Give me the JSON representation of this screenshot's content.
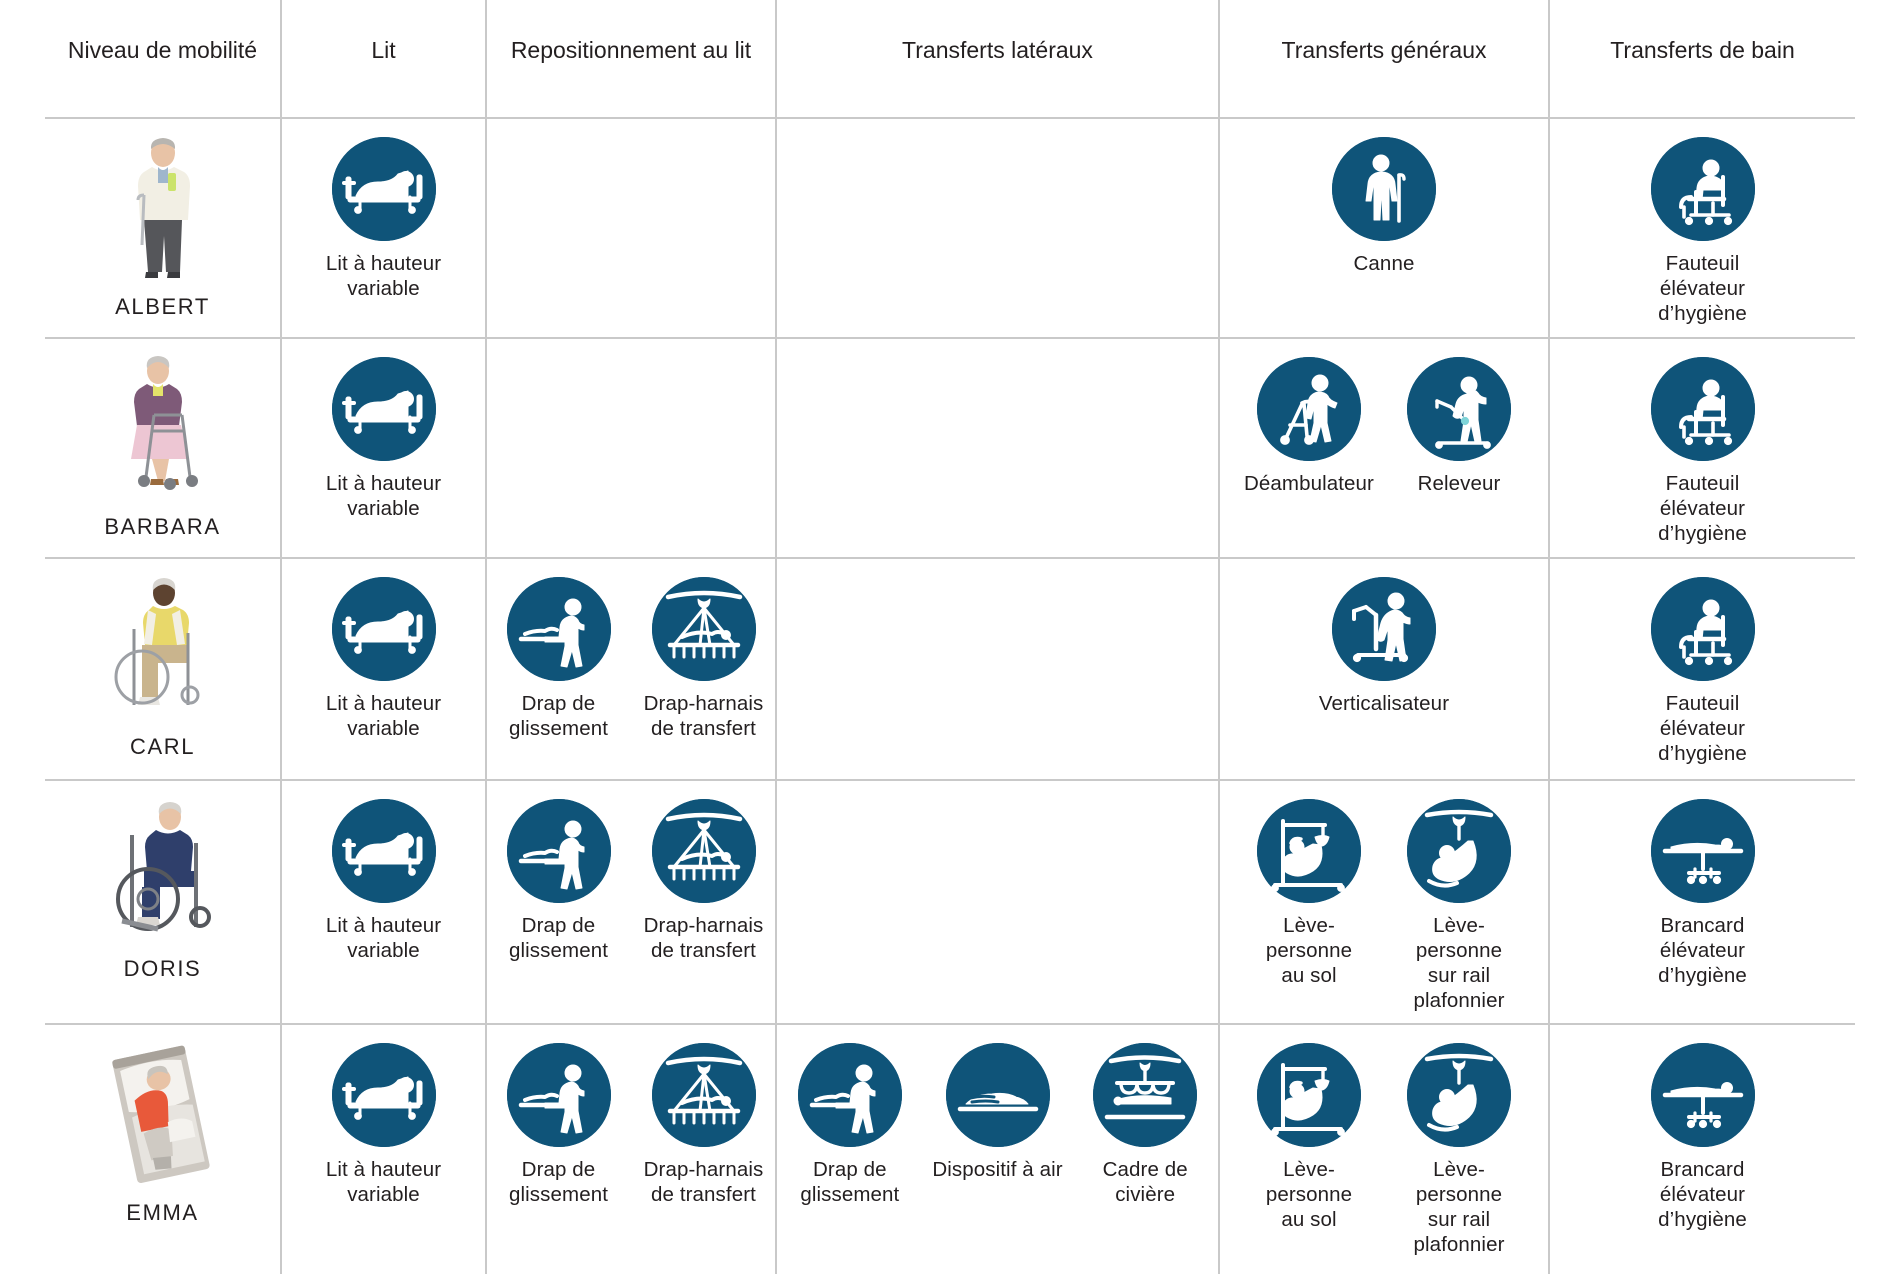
{
  "header": {
    "columns": [
      {
        "id": "mobility",
        "label": "Niveau\nde mobilité"
      },
      {
        "id": "bed",
        "label": "Lit"
      },
      {
        "id": "repositioning",
        "label": "Repositionnement au lit"
      },
      {
        "id": "lateral_transfers",
        "label": "Transferts latéraux"
      },
      {
        "id": "general_transfers",
        "label": "Transferts généraux"
      },
      {
        "id": "bath_transfers",
        "label": "Transferts\nde bain"
      }
    ]
  },
  "colors": {
    "badge_blue": "#0f5479",
    "grid_line": "#c9c9c9",
    "text": "#231f20",
    "page_background": "#ffffff"
  },
  "rows": [
    {
      "name": "ALBERT",
      "person_icon": "elderly-man-with-cane-photo",
      "bed": [
        {
          "label": "Lit à hauteur\nvariable",
          "icon": "height-adjustable-bed-icon"
        }
      ],
      "repositioning": [],
      "lateral_transfers": [],
      "general_transfers": [
        {
          "label": "Canne",
          "icon": "walking-cane-icon"
        }
      ],
      "bath_transfers": [
        {
          "label": "Fauteuil élévateur\nd’hygiène",
          "icon": "hygiene-lift-chair-icon"
        }
      ]
    },
    {
      "name": "BARBARA",
      "person_icon": "elderly-woman-with-rollator-photo",
      "bed": [
        {
          "label": "Lit à hauteur\nvariable",
          "icon": "height-adjustable-bed-icon"
        }
      ],
      "repositioning": [],
      "lateral_transfers": [],
      "general_transfers": [
        {
          "label": "Déambulateur",
          "icon": "rollator-walker-icon"
        },
        {
          "label": "Releveur",
          "icon": "sit-to-stand-lifter-icon"
        }
      ],
      "bath_transfers": [
        {
          "label": "Fauteuil élévateur\nd’hygiène",
          "icon": "hygiene-lift-chair-icon"
        }
      ]
    },
    {
      "name": "CARL",
      "person_icon": "man-in-wheelchair-photo",
      "bed": [
        {
          "label": "Lit à hauteur\nvariable",
          "icon": "height-adjustable-bed-icon"
        }
      ],
      "repositioning": [
        {
          "label": "Drap de\nglissement",
          "icon": "slide-sheet-icon"
        },
        {
          "label": "Drap-harnais\nde transfert",
          "icon": "transfer-sling-sheet-icon"
        }
      ],
      "lateral_transfers": [],
      "general_transfers": [
        {
          "label": "Verticalisateur",
          "icon": "standing-lift-icon"
        }
      ],
      "bath_transfers": [
        {
          "label": "Fauteuil élévateur\nd’hygiène",
          "icon": "hygiene-lift-chair-icon"
        }
      ]
    },
    {
      "name": "DORIS",
      "person_icon": "elderly-woman-in-wheelchair-photo",
      "bed": [
        {
          "label": "Lit à hauteur\nvariable",
          "icon": "height-adjustable-bed-icon"
        }
      ],
      "repositioning": [
        {
          "label": "Drap de\nglissement",
          "icon": "slide-sheet-icon"
        },
        {
          "label": "Drap-harnais\nde transfert",
          "icon": "transfer-sling-sheet-icon"
        }
      ],
      "lateral_transfers": [],
      "general_transfers": [
        {
          "label": "Lève-\npersonne\nau sol",
          "icon": "floor-lift-icon"
        },
        {
          "label": "Lève-personne\nsur rail\nplafonnier",
          "icon": "ceiling-rail-lift-icon"
        }
      ],
      "bath_transfers": [
        {
          "label": "Brancard élévateur\nd’hygiène",
          "icon": "hygiene-lift-stretcher-icon"
        }
      ]
    },
    {
      "name": "EMMA",
      "person_icon": "elderly-woman-lying-in-bed-photo",
      "bed": [
        {
          "label": "Lit à hauteur\nvariable",
          "icon": "height-adjustable-bed-icon"
        }
      ],
      "repositioning": [
        {
          "label": "Drap de\nglissement",
          "icon": "slide-sheet-icon"
        },
        {
          "label": "Drap-harnais\nde transfert",
          "icon": "transfer-sling-sheet-icon"
        }
      ],
      "lateral_transfers": [
        {
          "label": "Drap de\nglissement",
          "icon": "slide-sheet-icon"
        },
        {
          "label": "Dispositif à air",
          "icon": "air-assisted-device-icon"
        },
        {
          "label": "Cadre de\ncivière",
          "icon": "stretcher-frame-icon"
        }
      ],
      "general_transfers": [
        {
          "label": "Lève-\npersonne\nau sol",
          "icon": "floor-lift-icon"
        },
        {
          "label": "Lève-personne\nsur rail\nplafonnier",
          "icon": "ceiling-rail-lift-icon"
        }
      ],
      "bath_transfers": [
        {
          "label": "Brancard élévateur\nd’hygiène",
          "icon": "hygiene-lift-stretcher-icon"
        }
      ]
    }
  ]
}
